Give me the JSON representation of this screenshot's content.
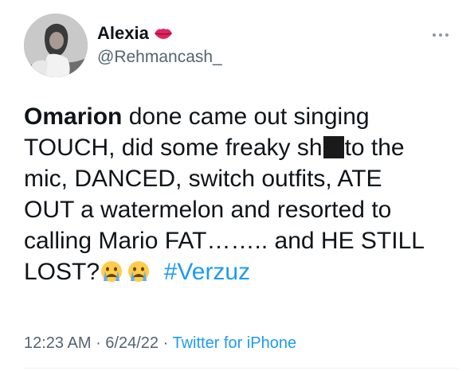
{
  "tweet": {
    "author": {
      "display_name": "Alexia",
      "handle": "@Rehmancash_",
      "name_emoji": "lips-icon"
    },
    "text": {
      "bold_name": "Omarion",
      "line1_rest": " done came out singing",
      "line2_a": "TOUCH, did some freaky sh",
      "line2_b": "to the",
      "line3": "mic, DANCED, switch outfits, ATE",
      "line4": "OUT a watermelon and resorted to",
      "line5": "calling Mario FAT…….. and HE STILL",
      "line6_a": "LOST?",
      "hashtag": "#Verzuz"
    },
    "meta": {
      "time": "12:23 AM",
      "separator1": " · ",
      "date": "6/24/22",
      "separator2": " · ",
      "source": "Twitter for iPhone"
    },
    "colors": {
      "text": "#0f1419",
      "secondary": "#536471",
      "link": "#1d9bf0"
    }
  }
}
